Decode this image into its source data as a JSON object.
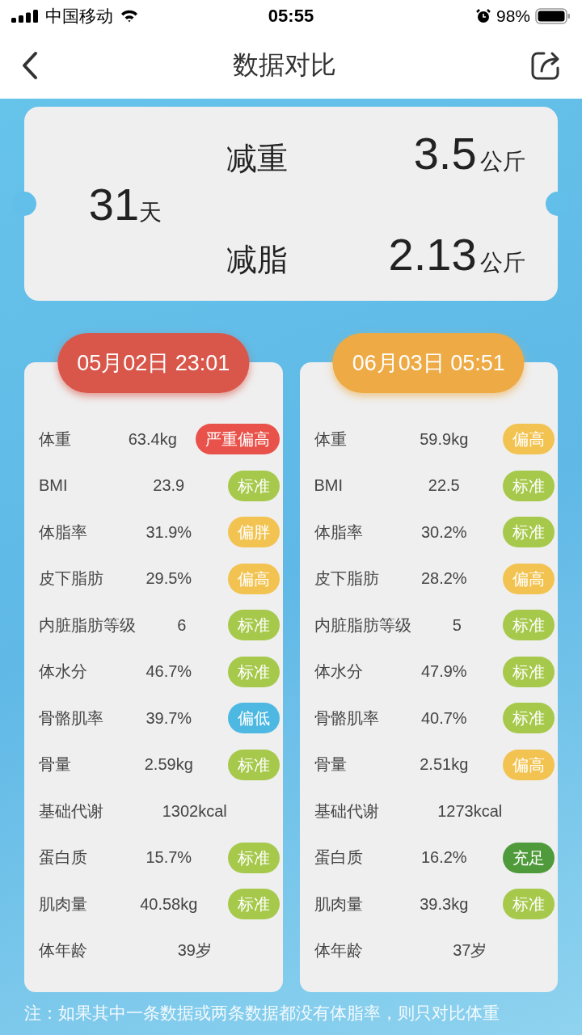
{
  "status_bar": {
    "carrier": "中国移动",
    "time": "05:55",
    "battery": "98%"
  },
  "nav": {
    "title": "数据对比"
  },
  "summary": {
    "days": "31",
    "days_unit": "天",
    "items": [
      {
        "label": "减重",
        "value": "3.5",
        "unit": "公斤"
      },
      {
        "label": "减脂",
        "value": "2.13",
        "unit": "公斤"
      }
    ]
  },
  "records": [
    {
      "date": "05月02日 23:01",
      "color": "#d9574a",
      "rows": [
        {
          "label": "体重",
          "value": "63.4kg",
          "badge": "严重偏高",
          "color": "#e8524a"
        },
        {
          "label": "BMI",
          "value": "23.9",
          "badge": "标准",
          "color": "#a6c94b"
        },
        {
          "label": "体脂率",
          "value": "31.9%",
          "badge": "偏胖",
          "color": "#f2c350"
        },
        {
          "label": "皮下脂肪",
          "value": "29.5%",
          "badge": "偏高",
          "color": "#f2c350"
        },
        {
          "label": "内脏脂肪等级",
          "value": "6",
          "badge": "标准",
          "color": "#a6c94b"
        },
        {
          "label": "体水分",
          "value": "46.7%",
          "badge": "标准",
          "color": "#a6c94b"
        },
        {
          "label": "骨骼肌率",
          "value": "39.7%",
          "badge": "偏低",
          "color": "#4db8e2"
        },
        {
          "label": "骨量",
          "value": "2.59kg",
          "badge": "标准",
          "color": "#a6c94b"
        },
        {
          "label": "基础代谢",
          "value": "1302kcal"
        },
        {
          "label": "蛋白质",
          "value": "15.7%",
          "badge": "标准",
          "color": "#a6c94b"
        },
        {
          "label": "肌肉量",
          "value": "40.58kg",
          "badge": "标准",
          "color": "#a6c94b"
        },
        {
          "label": "体年龄",
          "value": "39岁"
        }
      ]
    },
    {
      "date": "06月03日 05:51",
      "color": "#eeaa45",
      "rows": [
        {
          "label": "体重",
          "value": "59.9kg",
          "badge": "偏高",
          "color": "#f2c350"
        },
        {
          "label": "BMI",
          "value": "22.5",
          "badge": "标准",
          "color": "#a6c94b"
        },
        {
          "label": "体脂率",
          "value": "30.2%",
          "badge": "标准",
          "color": "#a6c94b"
        },
        {
          "label": "皮下脂肪",
          "value": "28.2%",
          "badge": "偏高",
          "color": "#f2c350"
        },
        {
          "label": "内脏脂肪等级",
          "value": "5",
          "badge": "标准",
          "color": "#a6c94b"
        },
        {
          "label": "体水分",
          "value": "47.9%",
          "badge": "标准",
          "color": "#a6c94b"
        },
        {
          "label": "骨骼肌率",
          "value": "40.7%",
          "badge": "标准",
          "color": "#a6c94b"
        },
        {
          "label": "骨量",
          "value": "2.51kg",
          "badge": "偏高",
          "color": "#f2c350"
        },
        {
          "label": "基础代谢",
          "value": "1273kcal"
        },
        {
          "label": "蛋白质",
          "value": "16.2%",
          "badge": "充足",
          "color": "#4f9a3a"
        },
        {
          "label": "肌肉量",
          "value": "39.3kg",
          "badge": "标准",
          "color": "#a6c94b"
        },
        {
          "label": "体年龄",
          "value": "37岁"
        }
      ]
    }
  ],
  "note": "注：如果其中一条数据或两条数据都没有体脂率，则只对比体重"
}
